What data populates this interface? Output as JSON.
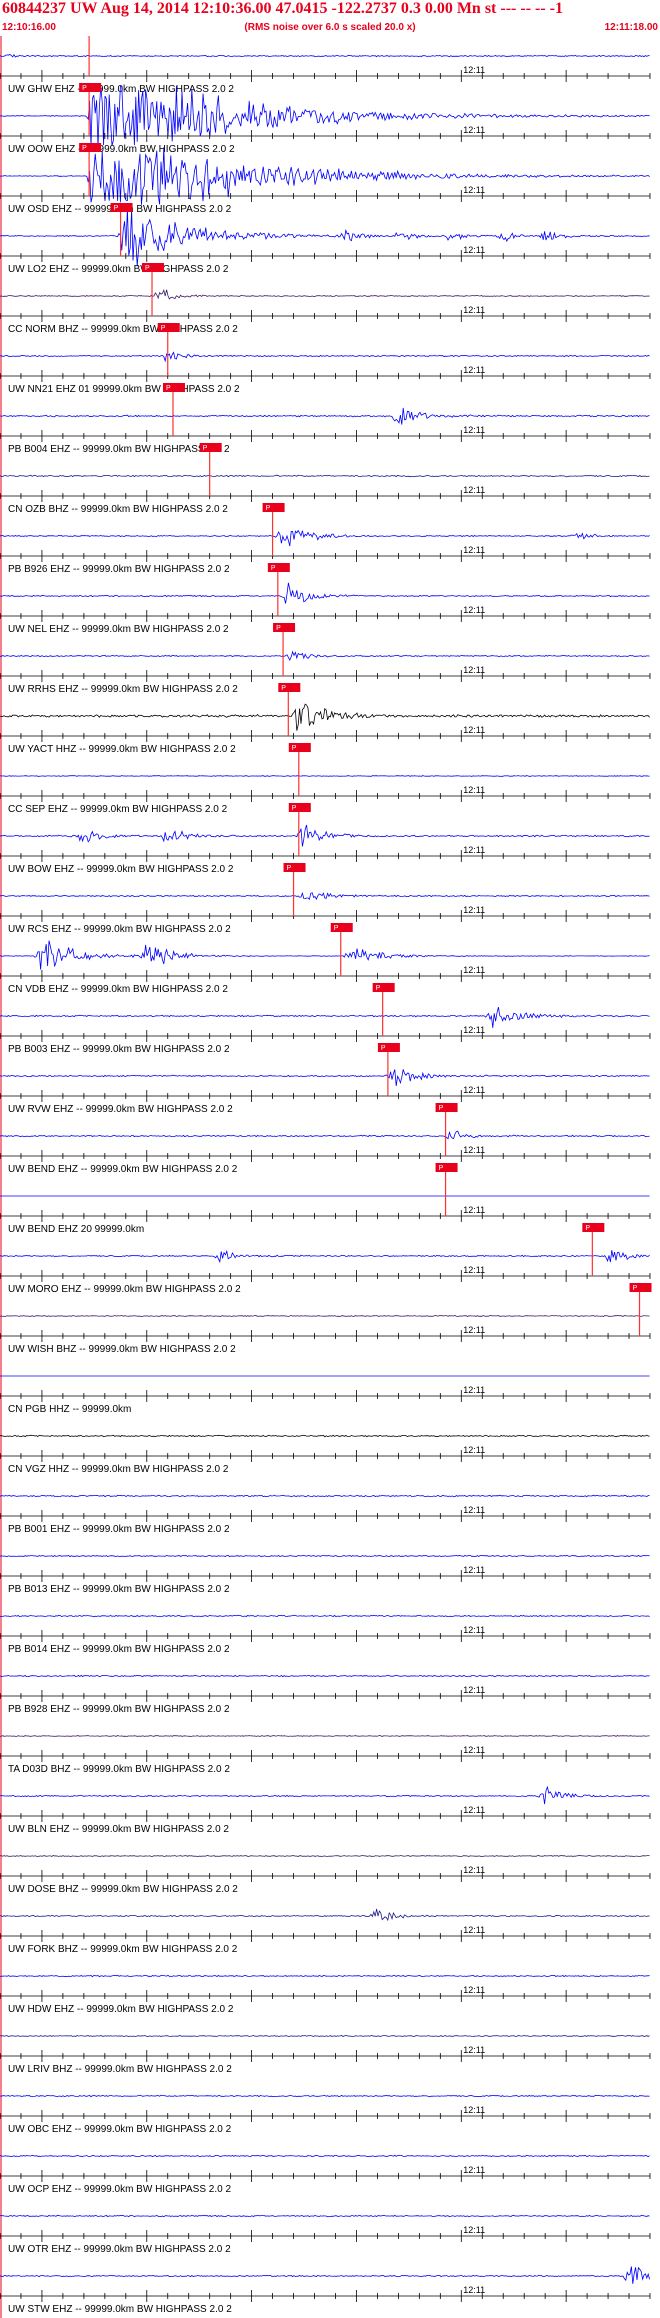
{
  "header": {
    "title": "60844237 UW Aug 14, 2014 12:10:36.00   47.0415  -122.2737  0.3 0.00 Mn st --- -- --  -1",
    "subtitle": "(RMS noise over 6.0 s scaled 20.0 x)",
    "start_time": "12:10:16.00",
    "end_time": "12:11:18.00"
  },
  "colors": {
    "header_text": "#e8001c",
    "pick_box": "#e8001c",
    "pick_line": "#ff3030",
    "trace_blue": "#0000ff",
    "trace_black": "#000000",
    "trace_navy": "#1a1a8c",
    "trace_purple": "#3a1a6a"
  },
  "chart_data": {
    "type": "line",
    "title": "60844237 UW Aug 14, 2014 12:10:36.00   47.0415  -122.2737  0.3 0.00 Mn st --- -- --  -1",
    "subtitle": "(RMS noise over 6.0 s scaled 20.0 x)",
    "xlabel": "",
    "ylabel": "",
    "x_range": [
      "12:10:16.00",
      "12:11:18.00"
    ],
    "xlim_seconds": [
      0,
      62
    ],
    "grid": false,
    "time_marker_label": "12:11",
    "time_marker_seconds": 44,
    "pick_label": "P",
    "series": [
      {
        "name": "UW GHW EHZ -- 99999.0km BW  HIGHPASS  2.0  2",
        "pick_s": 8.5,
        "amp": 0.45,
        "env": [
          [
            1,
            0.6
          ]
        ],
        "color": "#0000ff"
      },
      {
        "name": "UW OOW EHZ -- 99999.0km BW  HIGHPASS  2.0  2",
        "pick_s": 8.5,
        "amp": 0.3,
        "env": [
          [
            9,
            14
          ]
        ],
        "color": "#0000ff"
      },
      {
        "name": "UW OSD EHZ -- 99999.0km BW  HIGHPASS  2.0  2",
        "pick_s": 8.5,
        "amp": 0.3,
        "env": [
          [
            9,
            14
          ]
        ],
        "color": "#0000ff"
      },
      {
        "name": "UW LO2 EHZ -- 99999.0km BW  HIGHPASS  2.0  2",
        "pick_s": 11.5,
        "amp": 0.4,
        "env": [
          [
            12,
            7
          ],
          [
            33,
            1.5
          ],
          [
            38,
            1.5
          ],
          [
            43,
            1.5
          ],
          [
            48,
            1.5
          ],
          [
            52,
            1.5
          ]
        ],
        "color": "#0000ff"
      },
      {
        "name": "CC NORM BHZ -- 99999.0km BW  HIGHPASS  2.0  2",
        "pick_s": 14.5,
        "amp": 0.35,
        "env": [
          [
            15,
            2
          ]
        ],
        "color": "#3a1a6a"
      },
      {
        "name": "UW NN21 EHZ 01 99999.0km BW  HIGHPASS  2.0  2",
        "pick_s": 16.0,
        "amp": 0.45,
        "env": [
          [
            16,
            1.5
          ]
        ],
        "color": "#0000ff"
      },
      {
        "name": "PB B004 EHZ -- 99999.0km BW  HIGHPASS  2.0  2",
        "pick_s": 16.5,
        "amp": 0.55,
        "env": [
          [
            38,
            2.5
          ]
        ],
        "color": "#0000ff"
      },
      {
        "name": "CN OZB BHZ -- 99999.0km BW  HIGHPASS  2.0  2",
        "pick_s": 20.0,
        "amp": 0.5,
        "env": [],
        "color": "#1a1a8c"
      },
      {
        "name": "PB B926 EHZ -- 99999.0km BW  HIGHPASS  2.0  2",
        "pick_s": 26.0,
        "amp": 0.4,
        "env": [
          [
            27,
            3
          ],
          [
            55,
            1.5
          ]
        ],
        "color": "#0000ff"
      },
      {
        "name": "UW NEL EHZ -- 99999.0km BW  HIGHPASS  2.0  2",
        "pick_s": 26.5,
        "amp": 0.45,
        "env": [
          [
            27.5,
            2.5
          ]
        ],
        "color": "#0000ff"
      },
      {
        "name": "UW RRHS EHZ -- 99999.0km BW  HIGHPASS  2.0  2",
        "pick_s": 27.0,
        "amp": 0.4,
        "env": [
          [
            28,
            1.5
          ]
        ],
        "color": "#0000ff"
      },
      {
        "name": "UW YACT HHZ -- 99999.0km BW  HIGHPASS  2.0  2",
        "pick_s": 27.5,
        "amp": 0.85,
        "env": [
          [
            28.5,
            3.5
          ]
        ],
        "color": "#000000"
      },
      {
        "name": "CC SEP EHZ -- 99999.0km BW  HIGHPASS  2.0  2",
        "pick_s": 28.5,
        "amp": 0.25,
        "env": [],
        "color": "#0000ff"
      },
      {
        "name": "UW BOW EHZ -- 99999.0km BW  HIGHPASS  2.0  2",
        "pick_s": 28.5,
        "amp": 0.55,
        "env": [
          [
            8,
            1.8
          ],
          [
            16,
            2
          ],
          [
            29,
            2.5
          ]
        ],
        "color": "#0000ff"
      },
      {
        "name": "UW RCS EHZ -- 99999.0km BW  HIGHPASS  2.0  2",
        "pick_s": 28.0,
        "amp": 0.45,
        "env": [
          [
            29,
            2.2
          ]
        ],
        "color": "#0000ff"
      },
      {
        "name": "CN VDB EHZ -- 99999.0km BW  HIGHPASS  2.0  2",
        "pick_s": 32.5,
        "amp": 0.2,
        "env": [
          [
            4,
            4
          ],
          [
            14,
            3
          ],
          [
            33.5,
            3
          ]
        ],
        "color": "#0000ff"
      },
      {
        "name": "PB B003 EHZ -- 99999.0km BW  HIGHPASS  2.0  2",
        "pick_s": 36.5,
        "amp": 0.5,
        "env": [
          [
            47,
            3
          ]
        ],
        "color": "#0000ff"
      },
      {
        "name": "UW RVW EHZ -- 99999.0km BW  HIGHPASS  2.0  2",
        "pick_s": 37.0,
        "amp": 0.5,
        "env": [
          [
            37.5,
            2.5
          ]
        ],
        "color": "#0000ff"
      },
      {
        "name": "UW BEND EHZ -- 99999.0km BW  HIGHPASS  2.0  2",
        "pick_s": 42.5,
        "amp": 0.5,
        "env": [
          [
            43,
            1.5
          ]
        ],
        "color": "#0000ff"
      },
      {
        "name": "UW BEND EHZ 20 99999.0km",
        "pick_s": 42.5,
        "amp": 0.0,
        "env": [],
        "color": "#0000ff"
      },
      {
        "name": "UW MORO EHZ -- 99999.0km BW  HIGHPASS  2.0  2",
        "pick_s": 56.5,
        "amp": 0.45,
        "env": [
          [
            21,
            1.8
          ],
          [
            58,
            2
          ]
        ],
        "color": "#0000ff"
      },
      {
        "name": "UW WISH BHZ -- 99999.0km BW  HIGHPASS  2.0  2",
        "pick_s": 61.0,
        "amp": 0.35,
        "env": [],
        "color": "#3a1a6a"
      },
      {
        "name": "CN PGB HHZ -- 99999.0km",
        "pick_s": null,
        "amp": 0.0,
        "env": [],
        "color": "#0000ff"
      },
      {
        "name": "CN VGZ HHZ -- 99999.0km BW  HIGHPASS  2.0  2",
        "pick_s": null,
        "amp": 0.5,
        "env": [],
        "color": "#000000"
      },
      {
        "name": "PB B001 EHZ -- 99999.0km BW  HIGHPASS  2.0  2",
        "pick_s": null,
        "amp": 0.5,
        "env": [],
        "color": "#0000ff"
      },
      {
        "name": "PB B013 EHZ -- 99999.0km BW  HIGHPASS  2.0  2",
        "pick_s": null,
        "amp": 0.45,
        "env": [],
        "color": "#0000ff"
      },
      {
        "name": "PB B014 EHZ -- 99999.0km BW  HIGHPASS  2.0  2",
        "pick_s": null,
        "amp": 0.45,
        "env": [],
        "color": "#0000ff"
      },
      {
        "name": "PB B928 EHZ -- 99999.0km BW  HIGHPASS  2.0  2",
        "pick_s": null,
        "amp": 0.45,
        "env": [],
        "color": "#0000ff"
      },
      {
        "name": "TA D03D BHZ -- 99999.0km BW  HIGHPASS  2.0  2",
        "pick_s": null,
        "amp": 0.3,
        "env": [],
        "color": "#3a1a6a"
      },
      {
        "name": "UW BLN EHZ -- 99999.0km BW  HIGHPASS  2.0  2",
        "pick_s": null,
        "amp": 0.45,
        "env": [
          [
            52,
            2.2
          ]
        ],
        "color": "#0000ff"
      },
      {
        "name": "UW DOSE BHZ -- 99999.0km BW  HIGHPASS  2.0  2",
        "pick_s": null,
        "amp": 0.35,
        "env": [],
        "color": "#3a1a6a"
      },
      {
        "name": "UW FORK BHZ -- 99999.0km BW  HIGHPASS  2.0  2",
        "pick_s": null,
        "amp": 0.45,
        "env": [
          [
            36,
            2
          ]
        ],
        "color": "#1a1a8c"
      },
      {
        "name": "UW HDW EHZ -- 99999.0km BW  HIGHPASS  2.0  2",
        "pick_s": null,
        "amp": 0.45,
        "env": [],
        "color": "#0000ff"
      },
      {
        "name": "UW LRIV BHZ -- 99999.0km BW  HIGHPASS  2.0  2",
        "pick_s": null,
        "amp": 0.35,
        "env": [],
        "color": "#1a1a8c"
      },
      {
        "name": "UW OBC EHZ -- 99999.0km BW  HIGHPASS  2.0  2",
        "pick_s": null,
        "amp": 0.45,
        "env": [],
        "color": "#0000ff"
      },
      {
        "name": "UW OCP EHZ -- 99999.0km BW  HIGHPASS  2.0  2",
        "pick_s": null,
        "amp": 0.45,
        "env": [],
        "color": "#0000ff"
      },
      {
        "name": "UW OTR EHZ -- 99999.0km BW  HIGHPASS  2.0  2",
        "pick_s": null,
        "amp": 0.45,
        "env": [],
        "color": "#0000ff"
      },
      {
        "name": "UW STW EHZ -- 99999.0km BW  HIGHPASS  2.0  2",
        "pick_s": null,
        "amp": 0.45,
        "env": [
          [
            60,
            2.8
          ]
        ],
        "color": "#0000ff"
      }
    ]
  }
}
